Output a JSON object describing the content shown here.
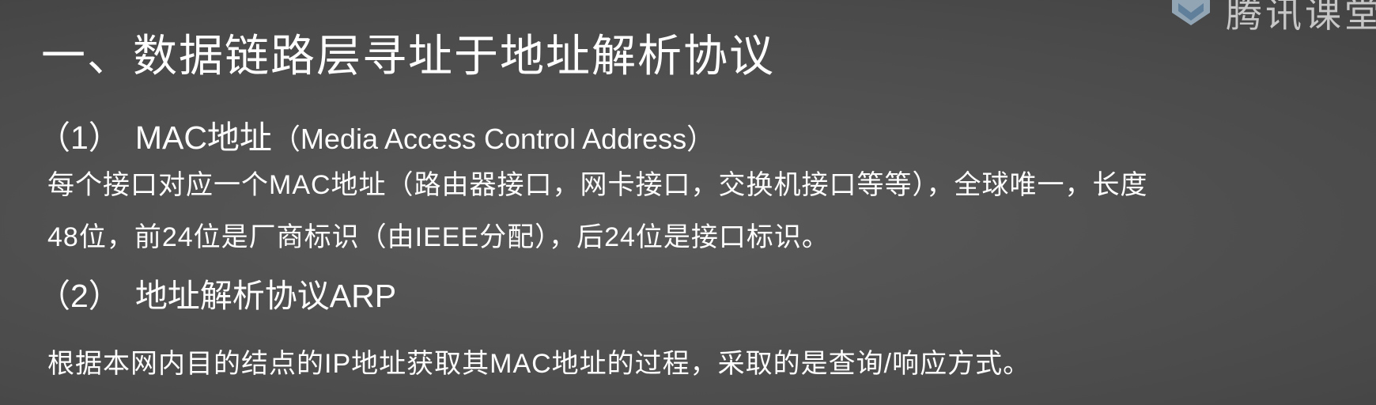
{
  "slide": {
    "top_cut_text": "",
    "watermark": {
      "text": "腾讯课堂",
      "logo_icon": "tencent-classroom-logo",
      "color": "#c7c7c7"
    },
    "title": "一、数据链路层寻址于地址解析协议",
    "sections": [
      {
        "number": "（1）",
        "heading": "MAC地址",
        "subheading": "（Media Access Control Address）",
        "lines": [
          "每个接口对应一个MAC地址（路由器接口，网卡接口，交换机接口等等），全球唯一，长度",
          "48位，前24位是厂商标识（由IEEE分配），后24位是接口标识。"
        ]
      },
      {
        "number": "（2）",
        "heading": "地址解析协议ARP",
        "subheading": "",
        "lines": [
          "根据本网内目的结点的IP地址获取其MAC地址的过程，采取的是查询/响应方式。"
        ]
      }
    ]
  },
  "colors": {
    "background": "#4a4a4a",
    "text": "#ffffff",
    "accent_top": "#e39a3a"
  }
}
